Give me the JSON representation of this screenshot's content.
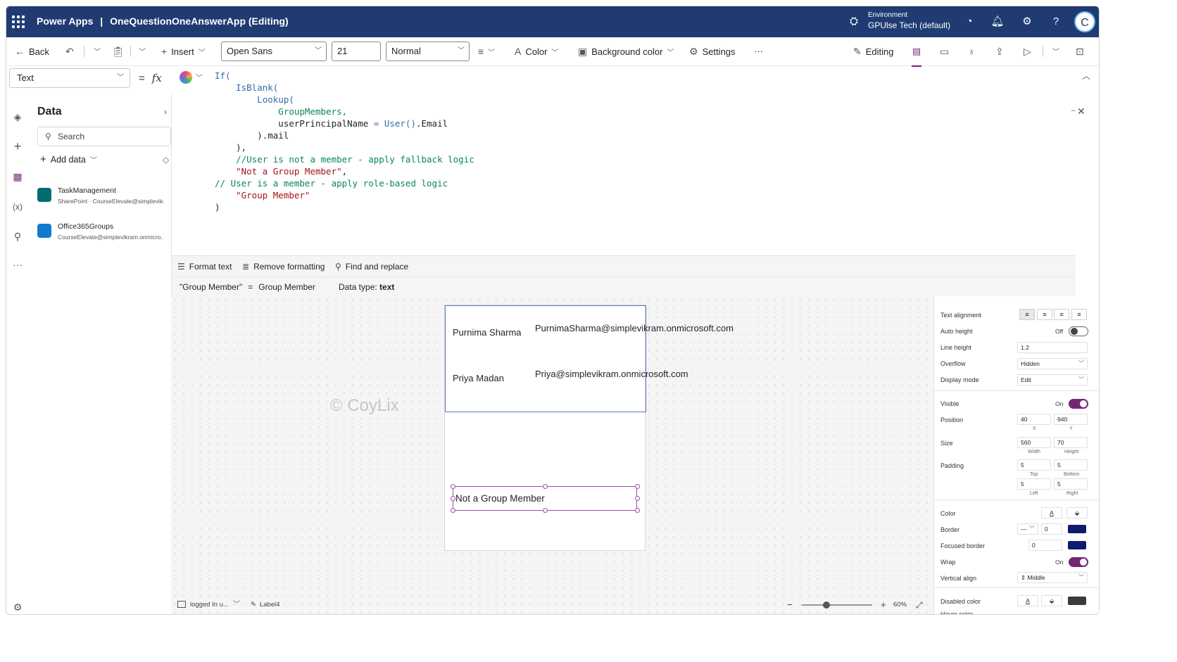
{
  "app": {
    "product": "Power Apps",
    "separator": "|",
    "app_name": "OneQuestionOneAnswerApp (Editing)",
    "environment_label": "Environment",
    "environment_name": "GPUlse Tech (default)",
    "avatar_initial": "C",
    "brand_color": "#1f3b72"
  },
  "toolbar": {
    "back_label": "Back",
    "insert_label": "Insert",
    "font": "Open Sans",
    "font_size": "21",
    "font_weight": "Normal",
    "color_label": "Color",
    "background_color_label": "Background color",
    "settings_label": "Settings",
    "more_label": "···",
    "editing_label": "Editing"
  },
  "formula": {
    "property": "Text",
    "equals": "=",
    "fx": "fx",
    "lines": [
      [
        {
          "t": "If(",
          "c": "kw"
        }
      ],
      [
        {
          "t": "    IsBlank(",
          "c": "kw"
        }
      ],
      [
        {
          "t": "        Lookup(",
          "c": "kw"
        }
      ],
      [
        {
          "t": "            GroupMembers,",
          "c": "fn"
        }
      ],
      [
        {
          "t": "            userPrincipalName",
          "c": "id"
        },
        {
          "t": " = ",
          "c": "kw"
        },
        {
          "t": "User()",
          "c": "kw"
        },
        {
          "t": ".Email",
          "c": "id"
        }
      ],
      [
        {
          "t": "        ).mail",
          "c": "id"
        }
      ],
      [
        {
          "t": "    ),",
          "c": "id"
        }
      ],
      [
        {
          "t": "    //User is not a member - apply fallback logic",
          "c": "cm"
        }
      ],
      [
        {
          "t": "    \"Not a Group Member\"",
          "c": "str"
        },
        {
          "t": ",",
          "c": "id"
        }
      ],
      [
        {
          "t": "// User is a member - apply role-based logic",
          "c": "cm"
        }
      ],
      [
        {
          "t": "    \"Group Member\"",
          "c": "str"
        }
      ],
      [
        {
          "t": ")",
          "c": "id"
        }
      ]
    ]
  },
  "format_bar": {
    "format_text": "Format text",
    "remove_formatting": "Remove formatting",
    "find_replace": "Find and replace"
  },
  "result": {
    "expression": "\"Group Member\"",
    "equals": "=",
    "value": "Group Member",
    "data_type_label": "Data type:",
    "data_type": "text"
  },
  "data_pane": {
    "title": "Data",
    "search_placeholder": "Search",
    "add_data": "Add data",
    "sources": [
      {
        "name": "TaskManagement",
        "subtitle": "SharePoint · CourseElevate@simplevikr..."
      },
      {
        "name": "Office365Groups",
        "subtitle": "CourseElevate@simplevikram.onmicro..."
      }
    ]
  },
  "canvas": {
    "rows": [
      {
        "name": "Purnima Sharma",
        "email": "PurnimaSharma@simplevikram.onmicrosoft.com"
      },
      {
        "name": "Priya Madan",
        "email": "Priya@simplevikram.onmicrosoft.com"
      }
    ],
    "label_text": "Not a Group Member",
    "watermark": "© CoyLix"
  },
  "status_bar": {
    "screen": "logged In u...",
    "control": "Label4",
    "zoom": "60%",
    "zoom_level_fraction": 0.35
  },
  "properties": {
    "text_alignment": "Text alignment",
    "auto_height": "Auto height",
    "auto_height_value": "Off",
    "line_height": "Line height",
    "line_height_value": "1.2",
    "overflow": "Overflow",
    "overflow_value": "Hidden",
    "display_mode": "Display mode",
    "display_mode_value": "Edit",
    "visible": "Visible",
    "visible_value": "On",
    "position": "Position",
    "position_x": "40",
    "position_y": "940",
    "x_label": "X",
    "y_label": "Y",
    "size": "Size",
    "width": "560",
    "height": "70",
    "width_label": "Width",
    "height_label": "Height",
    "padding": "Padding",
    "pad_top": "5",
    "pad_bottom": "5",
    "pad_left": "5",
    "pad_right": "5",
    "top_label": "Top",
    "bottom_label": "Bottom",
    "left_label": "Left",
    "right_label": "Right",
    "color": "Color",
    "border": "Border",
    "border_width": "0",
    "focused_border": "Focused border",
    "focused_border_value": "0",
    "wrap": "Wrap",
    "wrap_value": "On",
    "vertical_align": "Vertical align",
    "vertical_align_value": "Middle",
    "disabled_color": "Disabled color",
    "hover_color": "Hover color",
    "accent_color": "#742774",
    "border_color": "#0f1c6e"
  }
}
